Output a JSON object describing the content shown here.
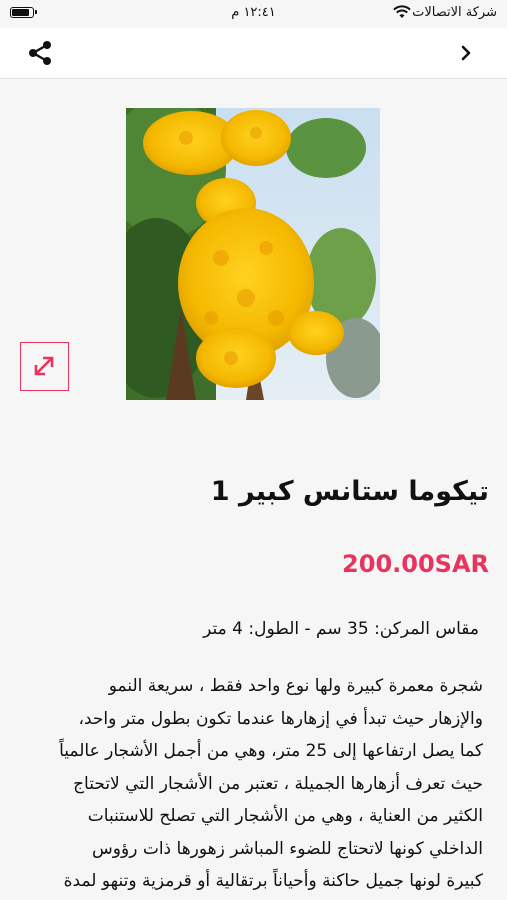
{
  "status_bar": {
    "carrier": "شركة الاتصالات",
    "time": "١٢:٤١ م",
    "battery_level": 0.9
  },
  "nav": {
    "icons": [
      "share-icon",
      "chevron-back-icon"
    ]
  },
  "product": {
    "title": "تيكوما ستانس كبير 1",
    "price": "200.00SAR",
    "size_info": "مقاس المركن: 35 سم - الطول: 4 متر",
    "description_lines": [
      "شجرة معمرة كبيرة ولها نوع واحد فقط ، سريعة النمو",
      "والإزهار حيث تبدأ في إزهارها عندما تكون بطول متر واحد،",
      "كما يصل ارتفاعها إلى 25 متر، وهي من أجمل الأشجار عالمياً",
      "حيث تعرف أزهارها الجميلة ، تعتبر من الأشجار التي لاتحتاج",
      "الكثير من العناية ، وهي من الأشجار التي تصلح للاستنبات",
      "الداخلي كونها لاتحتاج للضوء المباشر زهورها ذات رؤوس",
      "كبيرة لونها جميل حاكنة وأحياناً برتقالية أو قرمزية وتنهو لمدة"
    ],
    "accent_color": "#e8345f",
    "image_icon": "expand-icon"
  }
}
